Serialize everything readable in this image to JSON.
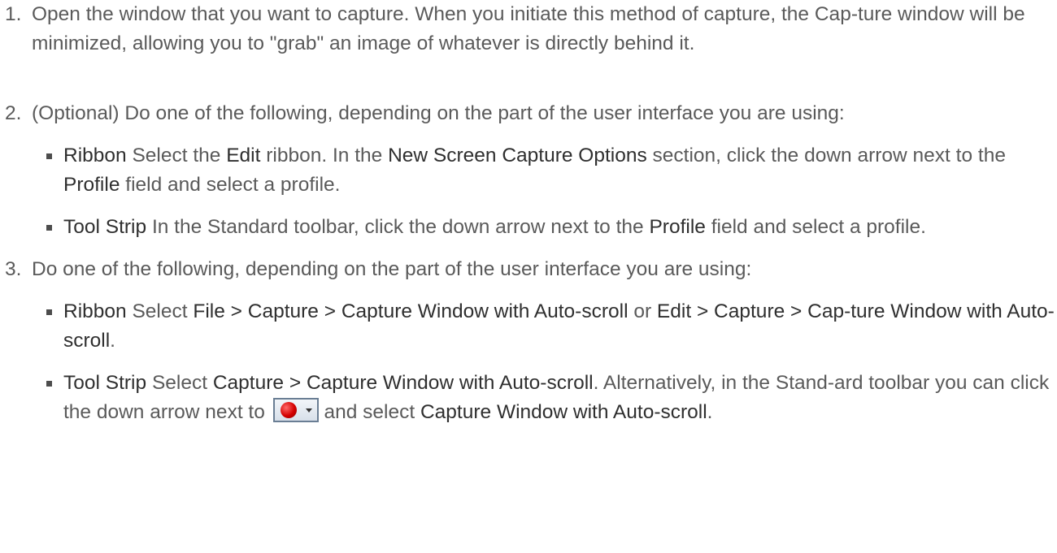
{
  "steps": [
    {
      "num": "1.",
      "text": "Open the window that you want to capture. When you initiate this method of capture, the Cap-ture window will be minimized, allowing you to \"grab\" an image of whatever is directly behind it."
    },
    {
      "num": "2.",
      "text": "(Optional) Do one of the following, depending on the part of the user interface you are using:",
      "items": [
        {
          "label": "Ribbon",
          "t1": " Select the ",
          "e1": "Edit",
          "t2": " ribbon. In the ",
          "e2": "New Screen Capture Options",
          "t3": " section, click the down arrow next to the ",
          "e3": "Profile",
          "t4": " field and select a profile."
        },
        {
          "label": "Tool Strip",
          "t1": " In the Standard toolbar, click the down arrow next to the ",
          "e1": "Profile",
          "t2": " field and select a profile."
        }
      ]
    },
    {
      "num": "3.",
      "text": "Do one of the following, depending on the part of the user interface you are using:",
      "items": [
        {
          "label": "Ribbon",
          "t1": " Select ",
          "e1": "File > Capture > Capture Window with Auto-scroll",
          "t2": " or ",
          "e2": "Edit > Capture > Cap-ture Window with Auto-scroll",
          "t3": "."
        },
        {
          "label": "Tool Strip",
          "t1": " Select ",
          "e1": "Capture > Capture Window with Auto-scroll",
          "t2": ". Alternatively, in the Stand-ard toolbar you can click the down arrow next to ",
          "icon": "record-button-icon",
          "t3": " and select ",
          "e2": "Capture Window with Auto-scroll",
          "t4": "."
        }
      ]
    }
  ]
}
